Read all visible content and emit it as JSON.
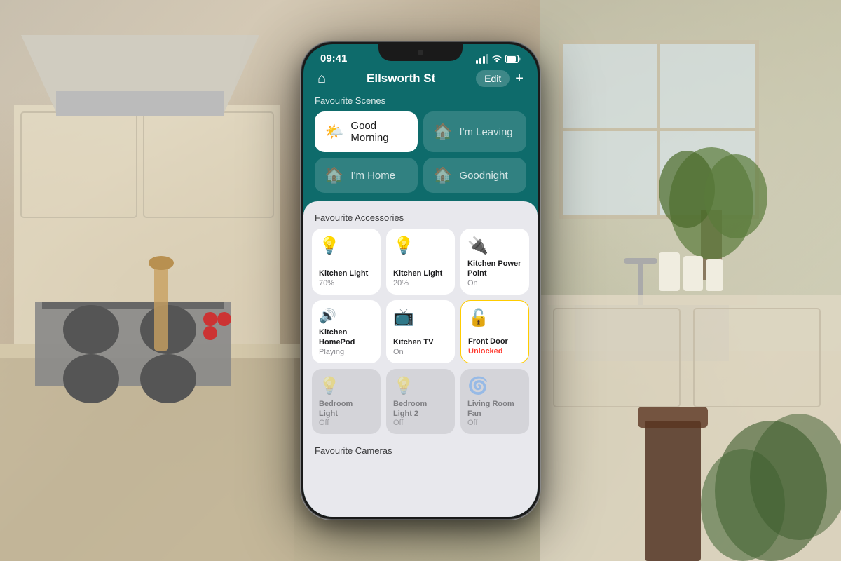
{
  "background": {
    "description": "Kitchen background"
  },
  "phone": {
    "status_bar": {
      "time": "09:41",
      "signal": "●●●",
      "wifi": "WiFi",
      "battery": "Battery"
    },
    "nav": {
      "home_icon": "⌂",
      "title": "Ellsworth St",
      "edit_label": "Edit",
      "add_label": "+"
    },
    "sections": {
      "scenes_label": "Favourite Scenes",
      "accessories_label": "Favourite Accessories",
      "cameras_label": "Favourite Cameras"
    },
    "scenes": [
      {
        "id": "good-morning",
        "label": "Good Morning",
        "icon": "🌤",
        "active": true
      },
      {
        "id": "im-leaving",
        "label": "I'm Leaving",
        "icon": "🏠",
        "active": false
      },
      {
        "id": "im-home",
        "label": "I'm Home",
        "icon": "🏠",
        "active": false
      },
      {
        "id": "goodnight",
        "label": "Goodnight",
        "icon": "🏠",
        "active": false
      }
    ],
    "accessories": [
      {
        "id": "kitchen-light-1",
        "name": "Kitchen Light",
        "status": "70%",
        "icon": "💡",
        "on": true
      },
      {
        "id": "kitchen-light-2",
        "name": "Kitchen Light",
        "status": "20%",
        "icon": "💡",
        "on": true
      },
      {
        "id": "kitchen-power",
        "name": "Kitchen Power Point",
        "status": "On",
        "icon": "🔌",
        "on": true
      },
      {
        "id": "kitchen-homepod",
        "name": "Kitchen HomePod",
        "status": "Playing",
        "icon": "🔊",
        "on": true
      },
      {
        "id": "kitchen-tv",
        "name": "Kitchen TV",
        "status": "On",
        "icon": "📺",
        "on": true
      },
      {
        "id": "front-door",
        "name": "Front Door",
        "status": "Unlocked",
        "icon": "🔓",
        "on": true,
        "alert": true
      },
      {
        "id": "bedroom-light",
        "name": "Bedroom Light",
        "status": "Off",
        "icon": "💡",
        "on": false
      },
      {
        "id": "bedroom-light-2",
        "name": "Bedroom Light 2",
        "status": "Off",
        "icon": "💡",
        "on": false
      },
      {
        "id": "living-room-fan",
        "name": "Living Room Fan",
        "status": "Off",
        "icon": "🌀",
        "on": false
      }
    ]
  }
}
